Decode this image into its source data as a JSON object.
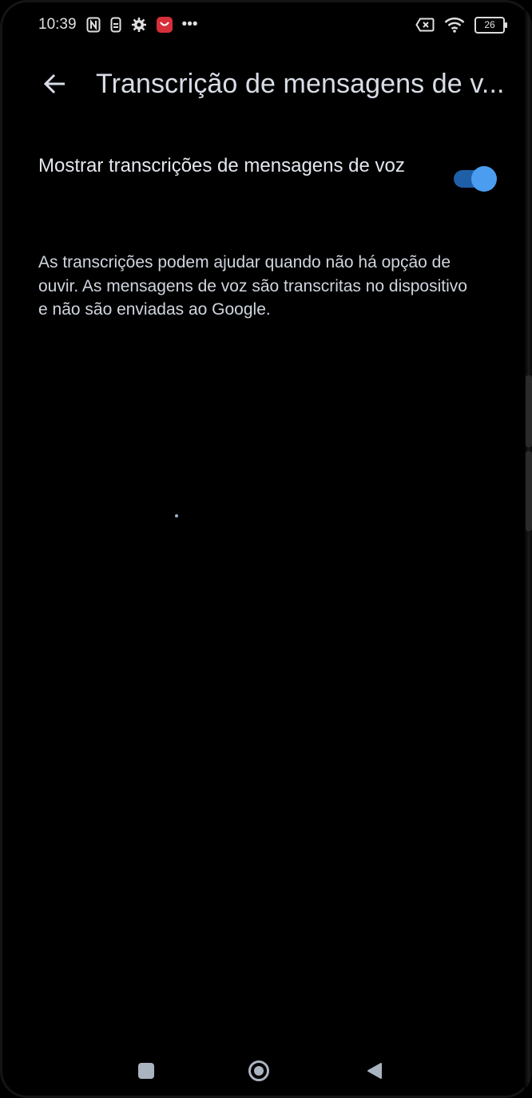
{
  "status_bar": {
    "time": "10:39",
    "battery_level": "26",
    "icons": [
      "nfc-icon",
      "data-saver-icon",
      "settings-icon",
      "app-notification-icon",
      "more-dots-icon",
      "sim-off-icon",
      "wifi-icon",
      "battery-icon"
    ],
    "more_label": "•••"
  },
  "header": {
    "title": "Transcrição de mensagens de v..."
  },
  "setting": {
    "label": "Mostrar transcrições de mensagens de voz",
    "enabled": true
  },
  "description": "As transcrições podem ajudar quando não há opção de ouvir. As mensagens de voz são transcritas no dispositivo e não são enviadas ao Google.",
  "colors": {
    "background": "#000000",
    "toggle_track": "#1f5fa8",
    "toggle_thumb": "#4b9df0",
    "text_primary": "#e3e7ee",
    "notification_badge": "#d62f3a"
  },
  "nav_bar": {
    "buttons": [
      "recents",
      "home",
      "back"
    ]
  }
}
